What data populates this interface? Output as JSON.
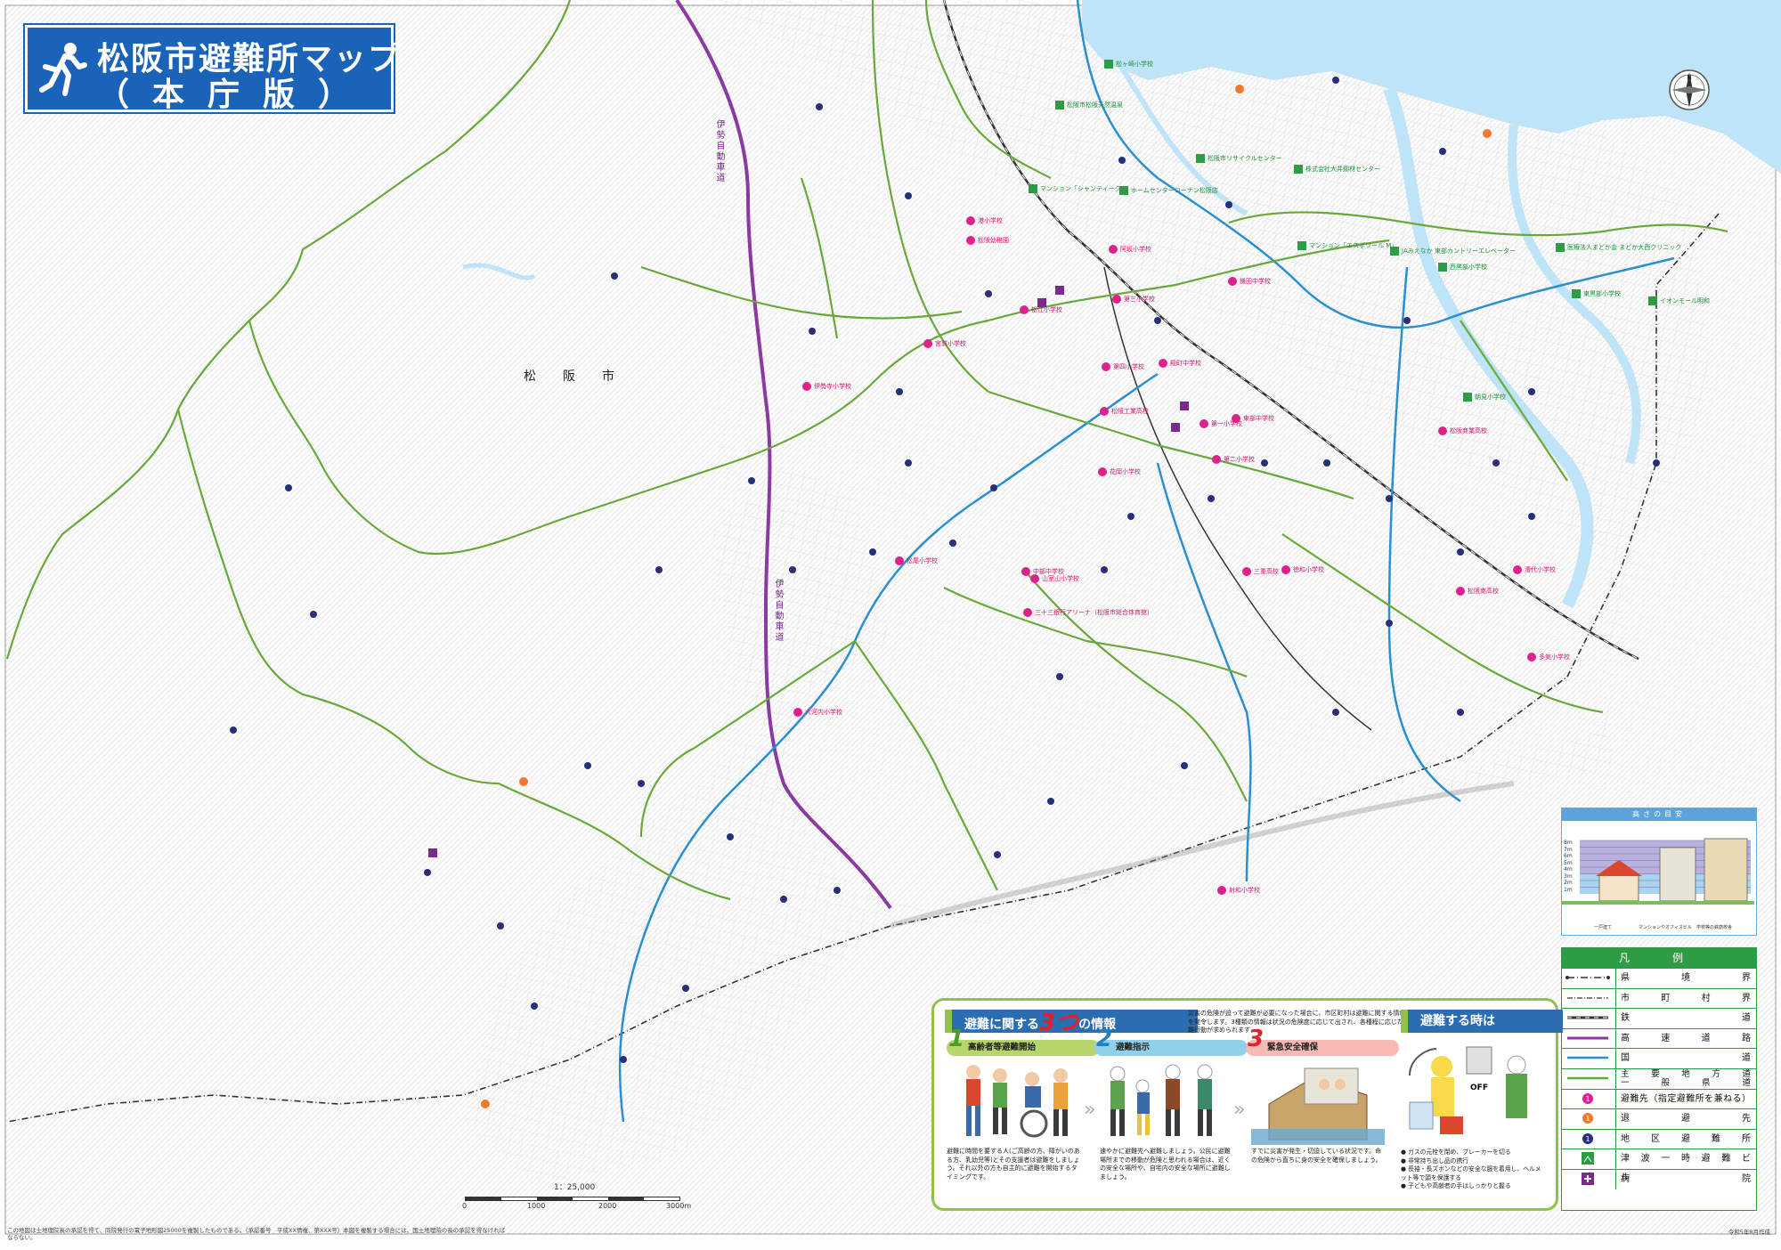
{
  "title": {
    "main": "松阪市避難所マップ",
    "sub": "（本庁版）"
  },
  "city_name": "松　阪　市",
  "expressway_name": "伊勢自動車道",
  "scale": {
    "label": "1：25,000",
    "ticks": [
      "0",
      "1000",
      "2000",
      "3000m"
    ]
  },
  "shelters": [
    {
      "name": "松ヶ崎小学校",
      "color": "green"
    },
    {
      "name": "松阪市リサイクルセンター",
      "color": "green"
    },
    {
      "name": "ホームセンターコーナン松阪店",
      "color": "green"
    },
    {
      "name": "マンション「シャンティーク」",
      "color": "green"
    },
    {
      "name": "株式会社大井鋼材センター",
      "color": "green"
    },
    {
      "name": "松阪市松阪天然温泉",
      "color": "green"
    },
    {
      "name": "マンション「エスポワール M」",
      "color": "green"
    },
    {
      "name": "JAみえなか 東部カントリーエレベーター",
      "color": "green"
    },
    {
      "name": "西黒部小学校",
      "color": "green"
    },
    {
      "name": "医療法人まどか会 まどか大西クリニック",
      "color": "green"
    },
    {
      "name": "東黒部小学校",
      "color": "green"
    },
    {
      "name": "イオンモール明和",
      "color": "green"
    },
    {
      "name": "朝見小学校",
      "color": "green"
    },
    {
      "name": "第三小学校",
      "color": "pink"
    },
    {
      "name": "第四小学校",
      "color": "pink"
    },
    {
      "name": "伊勢寺小学校",
      "color": "pink"
    },
    {
      "name": "松阪商業高校",
      "color": "pink"
    },
    {
      "name": "鎌田中学校",
      "color": "pink"
    },
    {
      "name": "東部中学校",
      "color": "pink"
    },
    {
      "name": "花岡小学校",
      "color": "pink"
    },
    {
      "name": "松江小学校",
      "color": "pink"
    },
    {
      "name": "殿町中学校",
      "color": "pink"
    },
    {
      "name": "第一小学校",
      "color": "pink"
    },
    {
      "name": "第二小学校",
      "color": "pink"
    },
    {
      "name": "松阪工業高校",
      "color": "pink"
    },
    {
      "name": "三重高校",
      "color": "pink"
    },
    {
      "name": "徳和小学校",
      "color": "pink"
    },
    {
      "name": "松阪南高校",
      "color": "pink"
    },
    {
      "name": "山室山小学校",
      "color": "pink"
    },
    {
      "name": "中部中学校",
      "color": "pink"
    },
    {
      "name": "三十三銀行アリーナ（松阪市総合体育館）",
      "color": "pink"
    },
    {
      "name": "大河内小学校",
      "color": "pink"
    },
    {
      "name": "松尾小学校",
      "color": "pink"
    },
    {
      "name": "射和小学校",
      "color": "pink"
    },
    {
      "name": "港小学校",
      "color": "pink"
    },
    {
      "name": "漕代小学校",
      "color": "pink"
    },
    {
      "name": "松阪幼稚園",
      "color": "pink"
    },
    {
      "name": "宮前小学校",
      "color": "pink"
    },
    {
      "name": "阿坂小学校",
      "color": "pink"
    },
    {
      "name": "多気小学校",
      "color": "pink"
    }
  ],
  "height_panel": {
    "title": "高さの目安",
    "levels": [
      "8m",
      "7m",
      "6m",
      "5m",
      "4m",
      "3m",
      "2m",
      "1m"
    ],
    "captions": [
      "一戸建て",
      "マンションやオフィスビル",
      "学校等の鉄筋校舎"
    ]
  },
  "legend": {
    "title": "凡　例",
    "items": [
      {
        "label": "県　　境　　界"
      },
      {
        "label": "市　町　村　界"
      },
      {
        "label": "鉄　　　　　道"
      },
      {
        "label": "高　速　道　路"
      },
      {
        "label": "国　　　　　道"
      },
      {
        "label": "主　要　地　方　道\n一　般　県　道"
      },
      {
        "label": "避難先（指定避難所を兼ねる）"
      },
      {
        "label": "退　　避　　先"
      },
      {
        "label": "地　区　避　難　所"
      },
      {
        "label": "津　波　一　時　避　難　ビ　ル"
      },
      {
        "label": "病　　　　　院"
      }
    ],
    "colors": {
      "prefecture": "#333333",
      "municipal": "#333333",
      "railway": "#333333",
      "expressway": "#8a3aa0",
      "national": "#2a8fd0",
      "prefectural": "#6aa83a",
      "evac_pink": "#e0208c",
      "refuge_orange": "#ef7a2a",
      "district_navy": "#2a2e7a",
      "tsunami_green": "#2e9c45",
      "hospital_purple": "#7a2a8c"
    }
  },
  "info_panel": {
    "title_pre": "避難に関する",
    "title_big": "3つ",
    "title_post": "の情報",
    "intro": "災害の危険が迫って避難が必要になった場合に、市区町村は避難に関する情報を発令します。3種類の情報は状況の危険度に応じて出され、各種程に応じた避難行動が求められます",
    "stages": [
      {
        "num": "1",
        "label": "高齢者等避難開始",
        "desc": "避難に時間を要する人(ご高齢の方、障がいのある方、乳幼児等)とその支援者は避難をしましょう。それ以外の方も自主的に避難を開始するタイミングです。"
      },
      {
        "num": "2",
        "label": "避難指示",
        "desc": "速やかに避難先へ避難しましょう。公民に避難場所までの移動が危険と思われる場合は、近くの安全な場所や、自宅内の安全な場所に避難しましょう。"
      },
      {
        "num": "3",
        "label": "緊急安全確保",
        "desc": "すでに災害が発生・切迫している状況です。命の危険から直ちに身の安全を確保しましょう。"
      }
    ],
    "when_title": "避難する時は",
    "tips": [
      "ガスの元栓を閉め、ブレーカーを切る",
      "非常持ち出し品の携行",
      "長袖・長ズボンなどの安全な服を着用し、ヘルメット等で頭を保護する",
      "子どもや高齢者の手はしっかりと握る"
    ],
    "off_label": "OFF"
  },
  "footnote": "この地図は土地理院長の承認を得て、同院発行の電子地形図25000を複製したものである。（承認番号　平成XX情複、第XXX号）本図を複製する場合には、国土地理院の長の承認を得なければならない。",
  "date": "令和5年8月作成"
}
